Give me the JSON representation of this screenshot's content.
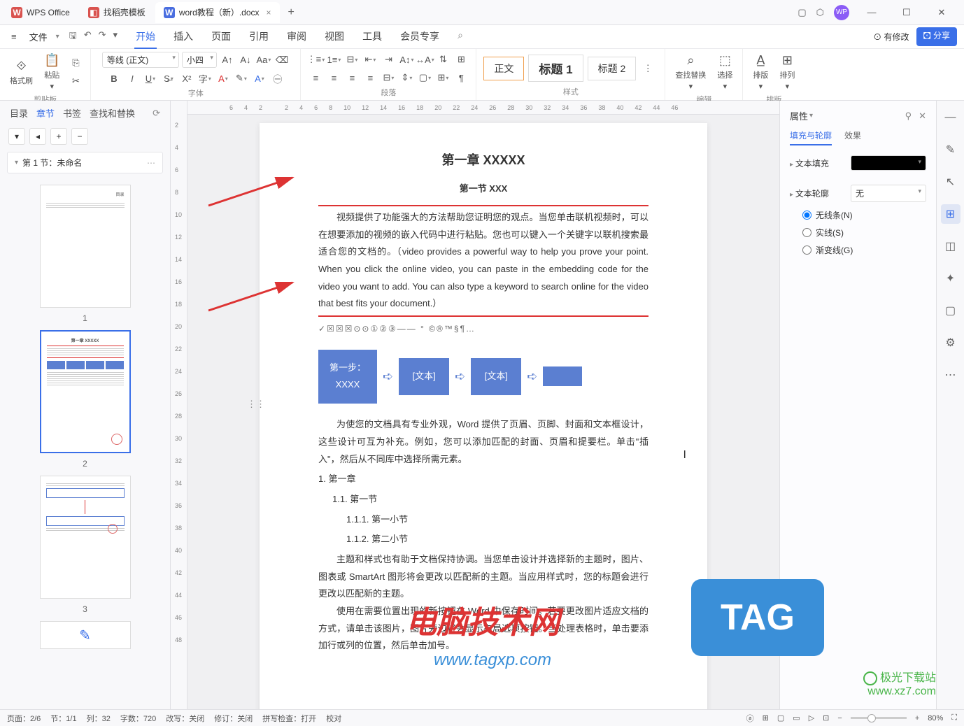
{
  "title_tabs": [
    {
      "icon": "W",
      "label": "WPS Office",
      "icon_class": "wps"
    },
    {
      "icon": "◧",
      "label": "找稻壳模板",
      "icon_class": "tpl"
    },
    {
      "icon": "W",
      "label": "word教程（新）.docx",
      "icon_class": "word",
      "active": true
    }
  ],
  "avatar": "WP",
  "menu": {
    "file": "文件",
    "tabs": [
      "开始",
      "插入",
      "页面",
      "引用",
      "审阅",
      "视图",
      "工具",
      "会员专享"
    ],
    "active_tab": "开始",
    "mod_label": "⊙ 有修改",
    "share_label": "🖸 分享"
  },
  "ribbon": {
    "clipboard": {
      "format": "格式刷",
      "paste": "粘贴",
      "label": "剪贴板"
    },
    "font": {
      "name": "等线 (正文)",
      "size": "小四",
      "label": "字体"
    },
    "para": {
      "label": "段落"
    },
    "styles": {
      "items": [
        "正文",
        "标题 1",
        "标题 2"
      ],
      "label": "样式"
    },
    "edit": {
      "find": "查找替换",
      "select": "选择",
      "label": "编辑"
    },
    "layout": {
      "layout": "排版",
      "arrange": "排列",
      "label": "排版"
    }
  },
  "left_panel": {
    "tabs": [
      "目录",
      "章节",
      "书签",
      "查找和替换"
    ],
    "active_tab": "章节",
    "section": "第 1 节：未命名",
    "thumbs": [
      "1",
      "2",
      "3"
    ]
  },
  "hruler": [
    "6",
    "4",
    "2",
    "",
    "2",
    "4",
    "6",
    "8",
    "10",
    "12",
    "14",
    "16",
    "18",
    "20",
    "22",
    "24",
    "26",
    "28",
    "30",
    "32",
    "34",
    "36",
    "38",
    "40",
    "42",
    "44",
    "46"
  ],
  "vruler": [
    "2",
    "4",
    "6",
    "8",
    "10",
    "12",
    "14",
    "16",
    "18",
    "20",
    "22",
    "24",
    "26",
    "28",
    "30",
    "32",
    "34",
    "36",
    "38",
    "40",
    "42",
    "44",
    "46",
    "48"
  ],
  "doc": {
    "h1": "第一章 XXXXX",
    "h2": "第一节 XXX",
    "p1": "视频提供了功能强大的方法帮助您证明您的观点。当您单击联机视频时，可以在想要添加的视频的嵌入代码中进行粘贴。您也可以键入一个关键字以联机搜索最适合您的文档的。（video provides a powerful way to help you prove your point. When you click the online video, you can paste in the embedding code for the video you want to add. You can also type a keyword to search online for the video that best fits your document.）",
    "symbols": "✓☒☒☒⊙⊙①②③—— ° ©®™§¶…",
    "flow": [
      "第一步：\nXXXX",
      "[文本]",
      "[文本]",
      ""
    ],
    "p2": "为使您的文档具有专业外观，Word 提供了页眉、页脚、封面和文本框设计，这些设计可互为补充。例如，您可以添加匹配的封面、页眉和提要栏。单击\"插入\"，然后从不同库中选择所需元素。",
    "toc": [
      "1.  第一章",
      "  1.1.  第一节",
      "    1.1.1.  第一小节",
      "    1.1.2.  第二小节"
    ],
    "p3": "主题和样式也有助于文档保持协调。当您单击设计并选择新的主题时，图片、图表或 SmartArt 图形将会更改以匹配新的主题。当应用样式时，您的标题会进行更改以匹配新的主题。",
    "p4": "使用在需要位置出现的新按钮在 Word 中保存时间。若要更改图片适应文档的方式，请单击该图片，图片旁边将会显示布局选项按钮。当处理表格时，单击要添加行或列的位置，然后单击加号。"
  },
  "right_panel": {
    "title": "属性",
    "tabs": [
      "填充与轮廓",
      "效果"
    ],
    "active_tab": "填充与轮廓",
    "fill_label": "文本填充",
    "outline_label": "文本轮廓",
    "outline_value": "无",
    "radios": [
      {
        "label": "无线条(N)",
        "checked": true
      },
      {
        "label": "实线(S)",
        "checked": false
      },
      {
        "label": "渐变线(G)",
        "checked": false
      }
    ]
  },
  "status": {
    "page": "页面：2/6",
    "section": "节：1/1",
    "column": "列：32",
    "words": "字数：720",
    "revise": "改写：关闭",
    "track": "修订：关闭",
    "spell": "拼写检查：打开",
    "proof": "校对",
    "zoom": "80%"
  },
  "watermarks": {
    "w1": "电脑技术网",
    "w1_sub": "www.tagxp.com",
    "w2": "TAG",
    "w3a": "极光下载站",
    "w3b": "www.xz7.com"
  }
}
